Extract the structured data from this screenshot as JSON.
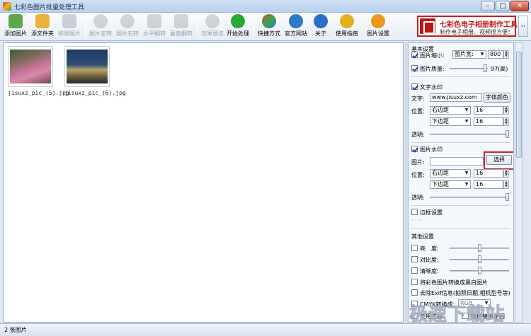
{
  "window": {
    "title": "七彩色图片批量处理工具",
    "min": "–",
    "max": "□",
    "close": "✕"
  },
  "toolbar": {
    "items": [
      {
        "label": "添加图片",
        "color": "#5fa84a"
      },
      {
        "label": "添文件夹",
        "color": "#e9b43a"
      },
      {
        "label": "移除图片",
        "color": "#7d8794"
      },
      {
        "label": "图片左转",
        "color": "#8a8f96"
      },
      {
        "label": "图片右转",
        "color": "#8a8f96"
      },
      {
        "label": "水平翻转",
        "color": "#8a8f96"
      },
      {
        "label": "垂直翻转",
        "color": "#8a8f96"
      },
      {
        "label": "效果预览",
        "color": "#8a8f96"
      },
      {
        "label": "开始处理",
        "color": "#2aa836"
      },
      {
        "label": "快捷方式",
        "color": "#d9453b"
      },
      {
        "label": "官方网站",
        "color": "#2d79c8"
      },
      {
        "label": "关于",
        "color": "#2b6fc4"
      },
      {
        "label": "使用指南",
        "color": "#e2b11e"
      },
      {
        "label": "图片设置",
        "color": "#e89a1e"
      }
    ]
  },
  "banner": {
    "title": "七彩色电子相册制作工具",
    "subtitle": "制作电子相册、视频很方便！"
  },
  "side_toggle": "‹‹",
  "images": [
    {
      "name": "jisuxz_pic_(5).jpg"
    },
    {
      "name": "jisuxz_pic_(6).jpg"
    }
  ],
  "panel": {
    "basic": {
      "header": "基本设置",
      "resize_label": "图片缩小:",
      "resize_mode": "图片宽:",
      "resize_value": "800",
      "quality_label": "图片质量:",
      "quality_value": "97(高)",
      "quality_level": 0.97
    },
    "text_wm": {
      "header": "文字水印",
      "text_label": "文字:",
      "text_value": "www.jisuxz.com",
      "font_color_btn": "字体颜色",
      "pos_label": "位置:",
      "h_pos": "右边距",
      "h_val": "16",
      "v_pos": "下边距",
      "v_val": "16",
      "opacity_label": "透明:",
      "opacity_level": 1.0
    },
    "image_wm": {
      "header": "图片水印",
      "img_label": "图片:",
      "choose_btn": "选择",
      "pos_label": "位置:",
      "h_pos": "右边距",
      "h_val": "16",
      "v_pos": "下边距",
      "v_val": "16",
      "opacity_label": "透明:",
      "opacity_level": 1.0
    },
    "border": {
      "header": "边框设置",
      "dots": "· · ·"
    },
    "other": {
      "header": "其他设置",
      "brightness": "亮　度:",
      "brightness_level": 0.5,
      "contrast": "对比度:",
      "contrast_level": 0.5,
      "sharpness": "清晰度:",
      "sharpness_level": 0.5,
      "grayscale": "将彩色图片转换成黑白图片",
      "remove_exif": "去除Exif信息(拍照日期,相机型号等)",
      "cmyk_label": "CMYK转换成:",
      "cmyk_value": "RGB",
      "bottom1": "使用方案",
      "bottom2": "直接替换原图"
    }
  },
  "status": {
    "count": "2 张图片"
  },
  "watermark": "极速下载站"
}
